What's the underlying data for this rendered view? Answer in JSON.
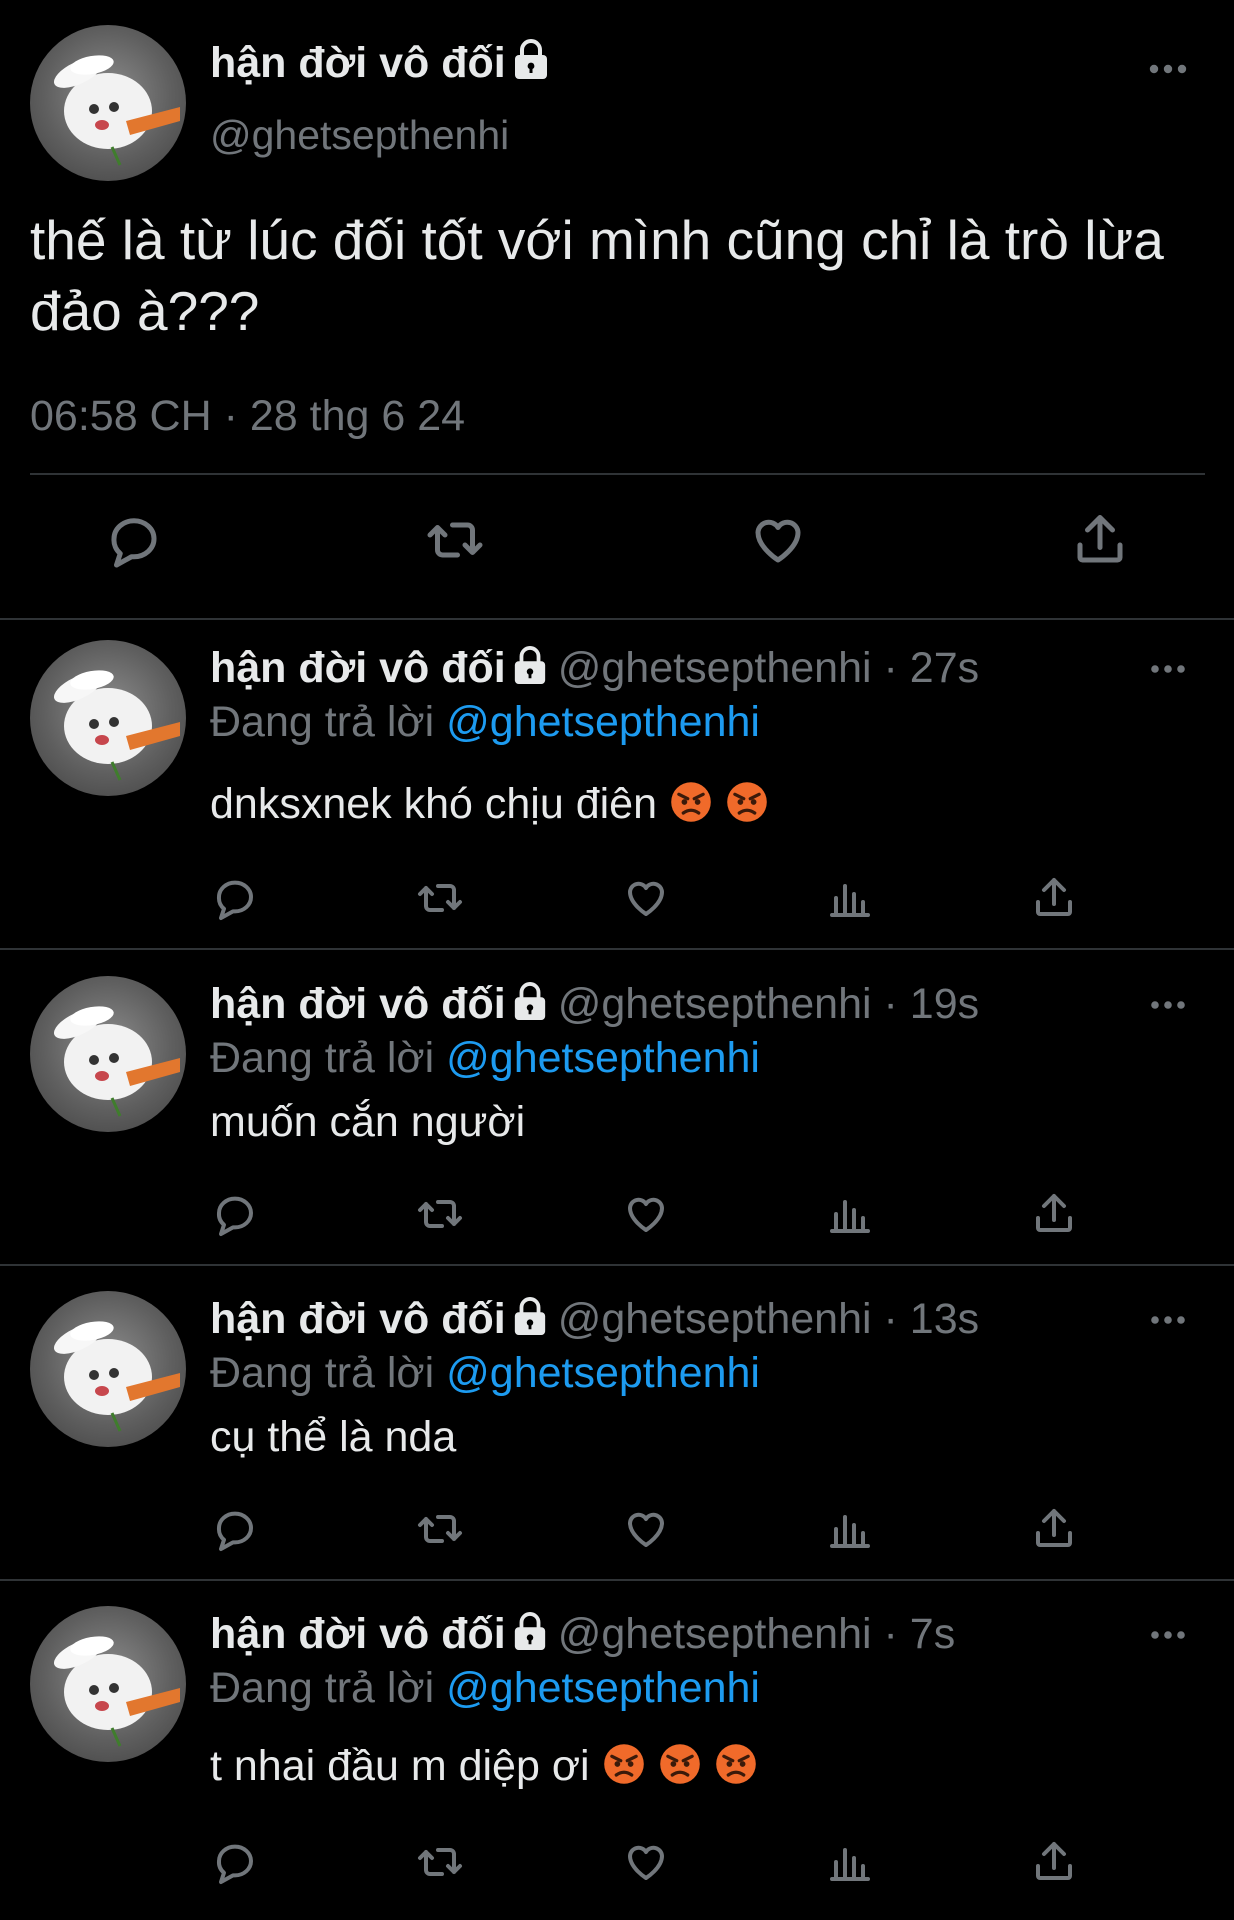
{
  "main_tweet": {
    "display_name": "hận đời vô đối",
    "handle": "@ghetsepthenhi",
    "text": "thế là từ lúc đối tốt với mình cũng chỉ là trò lừa đảo à???",
    "time": "06:58 CH · 28 thg 6 24",
    "icons": [
      "reply-icon",
      "retweet-icon",
      "like-icon",
      "share-icon"
    ]
  },
  "replies": [
    {
      "display_name": "hận đời vô đối",
      "handle": "@ghetsepthenhi",
      "age": " · 27s",
      "replying_label": "Đang trả lời",
      "replying_to": "@ghetsepthenhi",
      "text": "dnksxnek khó chịu điên",
      "emoji_count": 2
    },
    {
      "display_name": "hận đời vô đối",
      "handle": "@ghetsepthenhi",
      "age": " · 19s",
      "replying_label": "Đang trả lời",
      "replying_to": "@ghetsepthenhi",
      "text": "muốn cắn người",
      "emoji_count": 0
    },
    {
      "display_name": "hận đời vô đối",
      "handle": "@ghetsepthenhi",
      "age": " · 13s",
      "replying_label": "Đang trả lời",
      "replying_to": "@ghetsepthenhi",
      "text": "cụ thể là nda",
      "emoji_count": 0
    },
    {
      "display_name": "hận đời vô đối",
      "handle": "@ghetsepthenhi",
      "age": " · 7s",
      "replying_label": "Đang trả lời",
      "replying_to": "@ghetsepthenhi",
      "text": "t nhai đầu m diệp ơi",
      "emoji_count": 3
    }
  ],
  "colors": {
    "background": "#000000",
    "text": "#e7e9ea",
    "secondary": "#71767b",
    "accent": "#1d9bf0",
    "divider": "#2f3336"
  }
}
